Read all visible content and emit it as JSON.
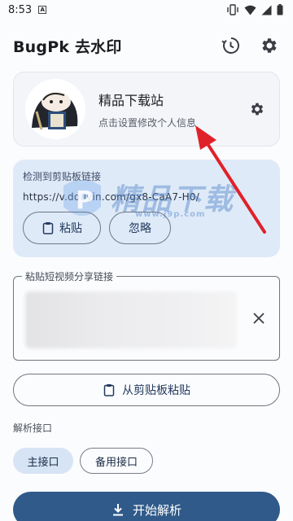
{
  "status_bar": {
    "time": "8:53",
    "notification_letter": "A"
  },
  "app_bar": {
    "title": "BugPk 去水印",
    "history_icon": "history-icon",
    "settings_icon": "gear-icon"
  },
  "profile": {
    "name": "精品下载站",
    "hint": "点击设置修改个人信息",
    "settings_icon": "gear-icon"
  },
  "clipboard_detect": {
    "label": "检测到剪贴板链接",
    "url": "https://v.douyin.com/gx8-CaA7-H0/",
    "paste_label": "粘贴",
    "ignore_label": "忽略"
  },
  "watermark": {
    "text": "精品下载",
    "sub": "www.j9p.com",
    "badge": "P"
  },
  "share_input": {
    "label": "粘贴短视频分享链接"
  },
  "clipboard_button": {
    "label": "从剪贴板粘贴"
  },
  "endpoint": {
    "label": "解析接口",
    "options": [
      "主接口",
      "备用接口"
    ],
    "selected": "主接口"
  },
  "parse_button": {
    "label": "开始解析"
  },
  "colors": {
    "primary": "#2f5a8a",
    "chip_selected": "#d7e4f5",
    "detect_card": "#dfeaf8",
    "annotation_arrow": "#e0212a"
  }
}
